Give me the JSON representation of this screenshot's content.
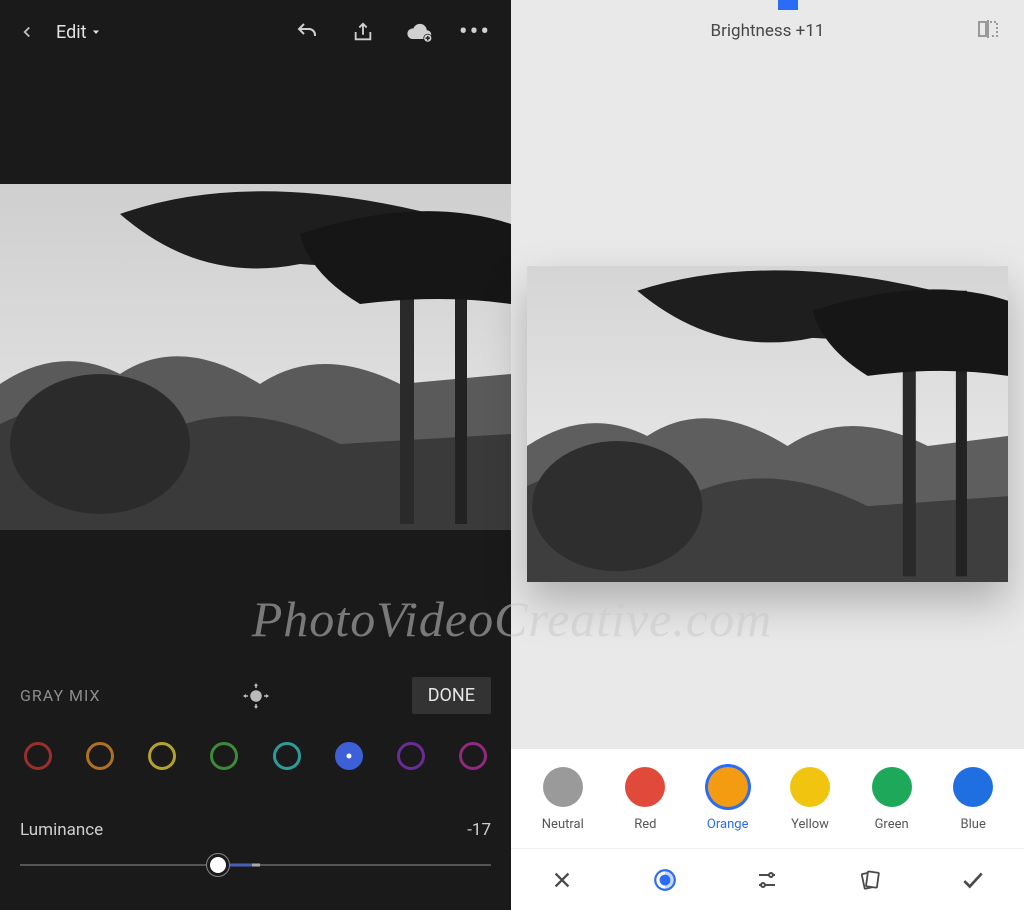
{
  "watermark": "PhotoVideoCreative.com",
  "left": {
    "header": {
      "edit_label": "Edit"
    },
    "gray_mix": {
      "label": "GRAY MIX",
      "done_label": "DONE"
    },
    "swatches": [
      {
        "name": "red",
        "color": "#9b2f2b",
        "selected": false
      },
      {
        "name": "orange",
        "color": "#b07023",
        "selected": false
      },
      {
        "name": "yellow",
        "color": "#b3a22a",
        "selected": false
      },
      {
        "name": "green",
        "color": "#3f8a3a",
        "selected": false
      },
      {
        "name": "teal",
        "color": "#2f9c9c",
        "selected": false
      },
      {
        "name": "blue",
        "color": "#3d5fd8",
        "selected": true
      },
      {
        "name": "purple",
        "color": "#6a2c96",
        "selected": false
      },
      {
        "name": "magenta",
        "color": "#8f2a7e",
        "selected": false
      }
    ],
    "slider": {
      "name": "Luminance",
      "value": "-17"
    }
  },
  "right": {
    "status": {
      "label": "Brightness +11"
    },
    "colors": [
      {
        "name": "Neutral",
        "color": "#9a9a9a",
        "selected": false
      },
      {
        "name": "Red",
        "color": "#e04a3a",
        "selected": false
      },
      {
        "name": "Orange",
        "color": "#f39c12",
        "selected": true
      },
      {
        "name": "Yellow",
        "color": "#f1c40f",
        "selected": false
      },
      {
        "name": "Green",
        "color": "#1ea85a",
        "selected": false
      },
      {
        "name": "Blue",
        "color": "#1f6fe0",
        "selected": false
      }
    ]
  }
}
